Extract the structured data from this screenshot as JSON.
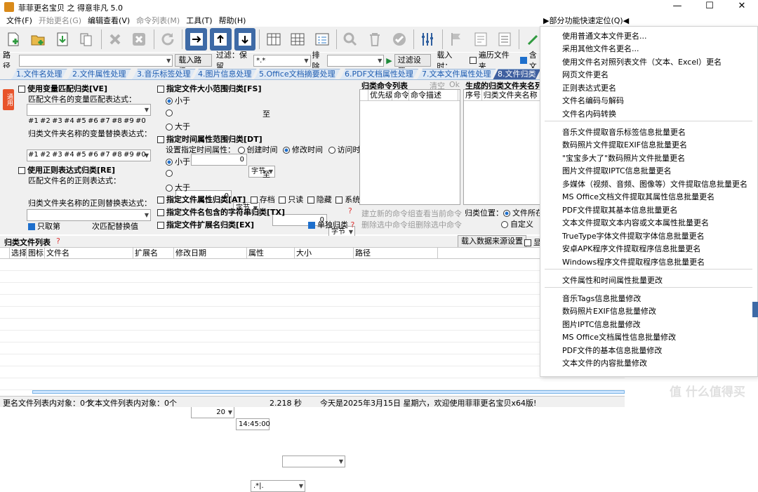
{
  "window": {
    "title": "菲菲更名宝贝 之 得意非凡 5.0",
    "min": "—",
    "max": "☐",
    "close": "✕"
  },
  "menu": [
    "文件(F)",
    "开始更名(G)",
    "编辑查看(V)",
    "命令列表(M)",
    "工具(T)",
    "帮助(H)"
  ],
  "menu_disabled": [
    false,
    true,
    false,
    true,
    false,
    false
  ],
  "quick_position": "▶部分功能快速定位(Q)◀",
  "pathbar": {
    "path_label": "路径",
    "path_value": "",
    "load_path": "载入路径",
    "filter_label": "过滤：保留",
    "filter_value": "*.*",
    "exclude_label": "排除",
    "exclude_value": "",
    "filter_settings": "过滤设置",
    "load_when": "载入时：",
    "traverse": "遍历文件夹",
    "include": "含文"
  },
  "tabs": [
    "1.文件名处理",
    "2.文件属性处理",
    "3.音乐标签处理",
    "4.图片信息处理",
    "5.Office文档摘要处理",
    "6.PDF文档属性处理",
    "7.文本文件属性处理",
    "8.文件归类"
  ],
  "side_tab": "通用",
  "ve": {
    "title": "使用变量匹配归类[VE]",
    "match_label": "匹配文件名的变量匹配表达式：",
    "nums": [
      "#1",
      "#2",
      "#3",
      "#4",
      "#5",
      "#6",
      "#7",
      "#8",
      "#9",
      "#0"
    ],
    "replace_label": "归类文件夹名称的变量替换表达式："
  },
  "re": {
    "title": "使用正则表达式归类[RE]",
    "match_label": "匹配文件名的正则表达式：",
    "replace_label": "归类文件夹名称的正则替换表达式：",
    "only_first": "只取第",
    "count": "1",
    "suffix": "次匹配替换值"
  },
  "fs": {
    "title": "指定文件大小范围归类[FS]",
    "less": "小于",
    "more": "大于",
    "to": "至",
    "v1": "0",
    "unit": "字节"
  },
  "dt": {
    "title": "指定时间属性范围归类[DT]",
    "attr_label": "设置指定时间属性：",
    "created": "创建时间",
    "modified": "修改时间",
    "accessed": "访问时间",
    "less": "小于",
    "more": "大于",
    "to": "至",
    "day": "20",
    "time": "14:45:00"
  },
  "at": {
    "title": "指定文件属性归类[AT]",
    "archive": "存档",
    "readonly": "只读",
    "hidden": "隐藏",
    "system": "系统"
  },
  "tx": {
    "title": "指定文件名包含的字符串归类[TX]"
  },
  "ex": {
    "title": "指定文件扩展名归类[EX]",
    "value": ".*|.",
    "single": "单独归类"
  },
  "cmdlist": {
    "title": "归类命令列表",
    "clear": "清空",
    "ok": "Ok",
    "cols": [
      "优先级",
      "命令",
      "命令描述"
    ],
    "add": "建立新的命令组",
    "view": "查看当前命令",
    "del_sel": "删除选中命令组",
    "del_cmd": "删除选中命令"
  },
  "folders": {
    "title": "生成的归类文件夹名列",
    "cols": [
      "序号",
      "归类文件夹名称"
    ],
    "pos_label": "归类位置：",
    "pos_file": "文件所在",
    "pos_custom": "自定义"
  },
  "filelist": {
    "title": "归类文件列表",
    "help": "?",
    "import_btn": "载入数据来源设置",
    "show": "显",
    "cols": [
      "选择",
      "图标",
      "文件名",
      "扩展名",
      "修改日期",
      "属性",
      "大小",
      "路径"
    ]
  },
  "status": {
    "left": "更名文件列表内对象：0个",
    "mid": "文本文件列表内对象：0个",
    "time": "2.218 秒",
    "date": "今天是2025年3月15日 星期六，欢迎使用菲菲更名宝贝x64版!"
  },
  "popup_menu": [
    [
      "使用普通文本文件更名...",
      "采用其他文件名更名...",
      "使用文件名对照列表文件（文本、Excel）更名",
      "网页文件更名",
      "正则表达式更名",
      "文件名编码与解码",
      "文件名内码转换"
    ],
    [
      "音乐文件提取音乐标签信息批量更名",
      "数码照片文件提取EXIF信息批量更名",
      "\"宝宝多大了\"数码照片文件批量更名",
      "图片文件提取IPTC信息批量更名",
      "多媒体（视频、音频、图像等）文件提取信息批量更名",
      "MS Office文档文件提取其属性信息批量更名",
      "PDF文件提取其基本信息批量更名",
      "文本文件提取文本内容或文本属性批量更名",
      "TrueType字体文件提取字体信息批量更名",
      "安卓APK程序文件提取程序信息批量更名",
      "Windows程序文件提取程序信息批量更名"
    ],
    [
      "文件属性和时间属性批量更改"
    ],
    [
      "音乐Tags信息批量修改",
      "数码照片EXIF信息批量修改",
      "图片IPTC信息批量修改",
      "MS Office文档属性信息批量修改",
      "PDF文件的基本信息批量修改",
      "文本文件的内容批量修改"
    ]
  ],
  "watermark": "值 什么值得买",
  "colors": {
    "accent": "#3e6aa6",
    "tab_active": "#3f5f9f",
    "side_tab": "#e8542b"
  }
}
